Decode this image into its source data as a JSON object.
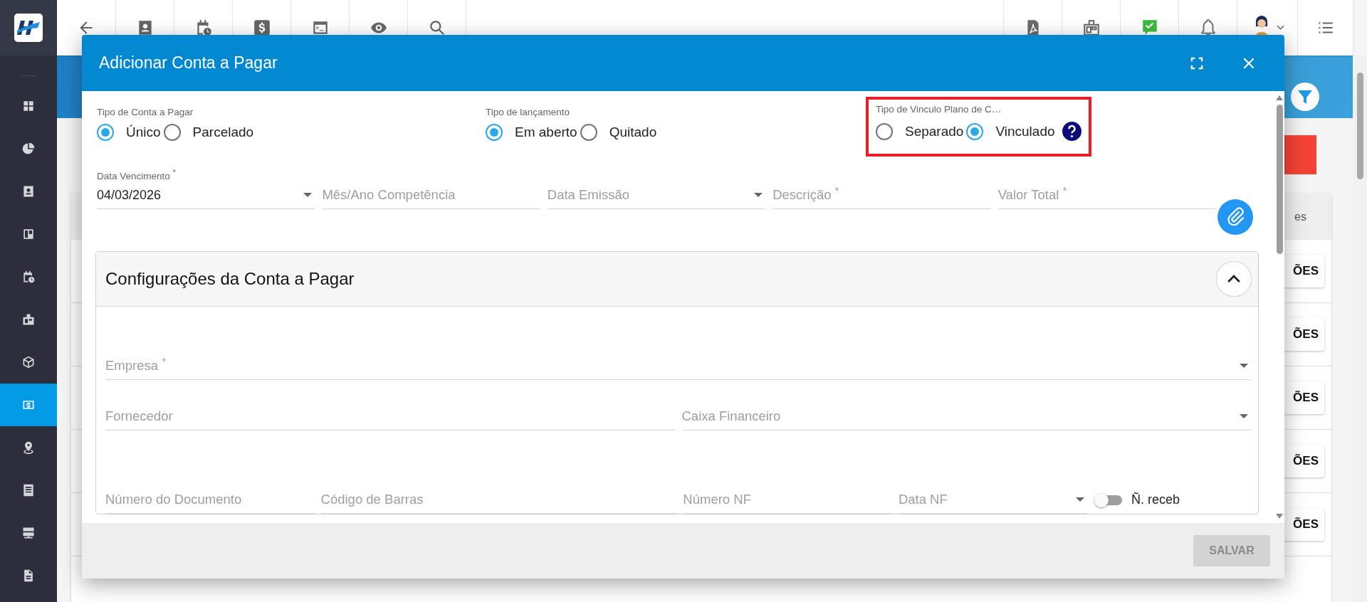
{
  "sidebar": {
    "items": [
      {
        "selected": false
      },
      {
        "selected": false
      },
      {
        "selected": false
      },
      {
        "selected": false
      },
      {
        "selected": false
      },
      {
        "selected": false
      },
      {
        "selected": false
      },
      {
        "selected": true
      },
      {
        "selected": false
      },
      {
        "selected": false
      },
      {
        "selected": false
      },
      {
        "selected": false
      }
    ]
  },
  "background": {
    "column_header": "es",
    "row_buttons": [
      "ÕES",
      "ÕES",
      "ÕES",
      "ÕES",
      "ÕES"
    ]
  },
  "modal": {
    "title": "Adicionar Conta a Pagar",
    "radio_groups": [
      {
        "label": "Tipo de Conta a Pagar",
        "highlighted": false,
        "help": false,
        "options": [
          {
            "label": "Único",
            "selected": true
          },
          {
            "label": "Parcelado",
            "selected": false
          }
        ]
      },
      {
        "label": "Tipo de lançamento",
        "highlighted": false,
        "help": false,
        "options": [
          {
            "label": "Em aberto",
            "selected": true
          },
          {
            "label": "Quitado",
            "selected": false
          }
        ]
      },
      {
        "label": "Tipo de Vinculo Plano de C…",
        "highlighted": true,
        "help": true,
        "options": [
          {
            "label": "Separado",
            "selected": false
          },
          {
            "label": "Vinculado",
            "selected": true
          }
        ]
      }
    ],
    "fields": [
      {
        "label": "Data Vencimento $^{*}$",
        "value": "04/03/2026",
        "kind": "dropdown"
      },
      {
        "label": "Mês/Ano Competência",
        "kind": "text"
      },
      {
        "label": "Data Emissão",
        "kind": "dropdown"
      },
      {
        "label": "Descrição $^{*}$",
        "kind": "text"
      },
      {
        "label": "Valor Total $^{*}$",
        "kind": "text"
      }
    ],
    "panel": {
      "title": "Configurações da Conta a Pagar",
      "expanded": true,
      "fields": [
        {
          "label": "Empresa $^{*}$",
          "kind": "dropdown"
        },
        {
          "label": "Fornecedor",
          "kind": "text"
        },
        {
          "label": "Caixa Financeiro",
          "kind": "dropdown"
        },
        {
          "label": "Número do Documento",
          "kind": "text"
        },
        {
          "label": "Código de Barras",
          "kind": "text"
        },
        {
          "label": "Número NF",
          "kind": "text"
        },
        {
          "label": "Data NF",
          "kind": "dropdown"
        }
      ],
      "toggle": {
        "label": "Ñ. receb",
        "on": false
      }
    },
    "save_button": {
      "label": "SALVAR",
      "disabled": true
    }
  }
}
